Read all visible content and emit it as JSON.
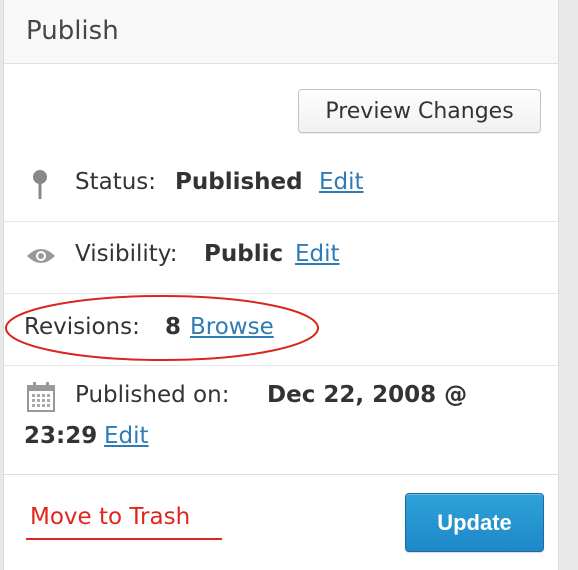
{
  "header": {
    "title": "Publish"
  },
  "actions": {
    "preview_label": "Preview Changes"
  },
  "status": {
    "label": "Status:",
    "value": "Published",
    "edit": "Edit"
  },
  "visibility": {
    "label": "Visibility:",
    "value": "Public",
    "edit": "Edit"
  },
  "revisions": {
    "label": "Revisions:",
    "count": "8",
    "browse": "Browse"
  },
  "published_on": {
    "label": "Published on:",
    "date": "Dec 22, 2008 @",
    "time": "23:29",
    "edit": "Edit"
  },
  "footer": {
    "trash_label": "Move to Trash",
    "update_label": "Update"
  },
  "colors": {
    "link": "#2e7bb6",
    "trash": "#e0261c",
    "primary": "#1e88c8",
    "annotation": "#d9261c"
  },
  "icons": {
    "status": "pin-icon",
    "visibility": "eye-icon",
    "published_on": "calendar-icon"
  }
}
